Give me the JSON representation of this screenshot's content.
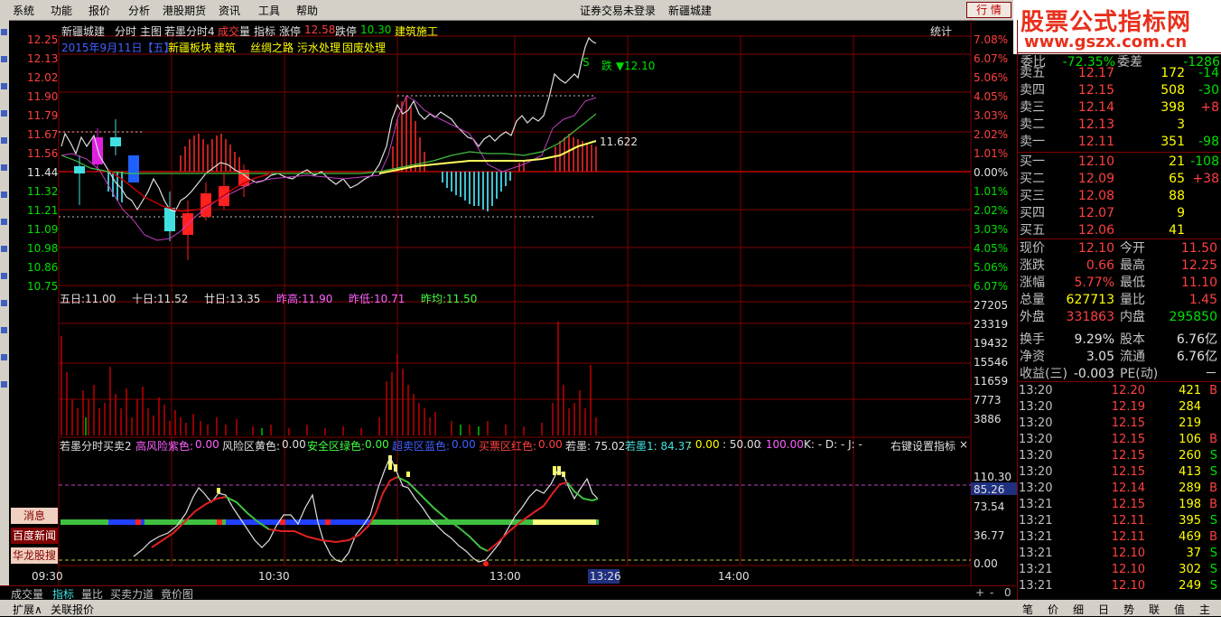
{
  "menu": {
    "items": [
      "系统",
      "功能",
      "报价",
      "分析",
      "港股期货",
      "资讯",
      "工具",
      "帮助"
    ],
    "status": "证券交易未登录",
    "stock": "新疆城建",
    "hq_button": "行 情"
  },
  "logo": {
    "line1": "股票公式指标网",
    "line2": "www.gszx.com.cn"
  },
  "side_buttons": [
    "消息",
    "百度新闻",
    "华龙股搜"
  ],
  "chart_header": {
    "stock": "新疆城建",
    "items": [
      "分时",
      "主图",
      "若墨分时4"
    ],
    "volume_label_1": "成交",
    "volume_label_2": "量",
    "indicator": "指标",
    "limit_up_label": "涨停",
    "limit_up": "12.58",
    "limit_down_label": "跌停",
    "limit_down": "10.30",
    "sector": "建筑施工",
    "stat_button": "统计",
    "date": "2015年9月11日【五】",
    "concepts": [
      "新疆板块",
      "建筑",
      "丝绸之路",
      "污水处理",
      "固废处理"
    ],
    "down_marker": "跌 ▼12.10",
    "avg_marker": "11.622",
    "s_marker": "S"
  },
  "price_axis": {
    "left": [
      "12.25",
      "12.13",
      "12.02",
      "11.90",
      "11.79",
      "11.67",
      "11.56",
      "11.44",
      "11.32",
      "11.21",
      "11.09",
      "10.98",
      "10.86",
      "10.75"
    ],
    "right": [
      "7.08%",
      "6.07%",
      "5.06%",
      "4.05%",
      "3.03%",
      "2.02%",
      "1.01%",
      "0.00%",
      "1.01%",
      "2.02%",
      "3.03%",
      "4.05%",
      "5.06%",
      "6.07%"
    ]
  },
  "ma_line": {
    "ma5": "五日:11.00",
    "ma10": "十日:11.52",
    "ma20": "廿日:13.35",
    "prev_high": "昨高:11.90",
    "prev_low": "昨低:10.71",
    "prev_avg": "昨均:11.50"
  },
  "volume_axis": [
    "27205",
    "23319",
    "19432",
    "15546",
    "11659",
    "7773",
    "3886"
  ],
  "indicator_header": {
    "name": "若墨分时买卖2",
    "high_risk": "高风险紫色:",
    "high_risk_v": "0.00",
    "risk": "风险区黄色:",
    "risk_v": "0.00",
    "safe": "安全区绿色:",
    "safe_v": "0.00",
    "oversold": "超卖区蓝色:",
    "oversold_v": "0.00",
    "buy": "买票区红色:",
    "buy_v": "0.00",
    "rm": "若墨: 75.02",
    "rm1": "若墨1: 84.37",
    "rm2": ": 0.00",
    "rm3": ": 50.00",
    "rm4": ": 100.00",
    "kdj": "K: -  D: -  J: -",
    "right_set": "右键设置指标",
    "close": "×"
  },
  "indicator_axis": [
    "110.30",
    "85.26",
    "73.54",
    "36.77",
    "0.00"
  ],
  "time_axis": [
    "09:30",
    "10:30",
    "13:00",
    "13:26",
    "14:00"
  ],
  "bottom_tabs": [
    "成交量",
    "指标",
    "量比",
    "买卖力道",
    "竟价图"
  ],
  "bottom_controls": [
    "+",
    "-",
    "0"
  ],
  "bottom_links": [
    "扩展∧",
    "关联报价"
  ],
  "right_tabs": [
    "笔",
    "价",
    "细",
    "日",
    "势",
    "联",
    "值",
    "主"
  ],
  "order_book": {
    "head": {
      "label1": "委比",
      "v1": "-72.35%",
      "label2": "委差",
      "v2": "-1286"
    },
    "sells": [
      {
        "label": "卖五",
        "price": "12.17",
        "vol": "172",
        "chg": "-14"
      },
      {
        "label": "卖四",
        "price": "12.15",
        "vol": "508",
        "chg": "-30"
      },
      {
        "label": "卖三",
        "price": "12.14",
        "vol": "398",
        "chg": "+8"
      },
      {
        "label": "卖二",
        "price": "12.13",
        "vol": "3",
        "chg": ""
      },
      {
        "label": "卖一",
        "price": "12.11",
        "vol": "351",
        "chg": "-98"
      }
    ],
    "buys": [
      {
        "label": "买一",
        "price": "12.10",
        "vol": "21",
        "chg": "-108"
      },
      {
        "label": "买二",
        "price": "12.09",
        "vol": "65",
        "chg": "+38"
      },
      {
        "label": "买三",
        "price": "12.08",
        "vol": "88",
        "chg": ""
      },
      {
        "label": "买四",
        "price": "12.07",
        "vol": "9",
        "chg": ""
      },
      {
        "label": "买五",
        "price": "12.06",
        "vol": "41",
        "chg": ""
      }
    ]
  },
  "quote": [
    {
      "l1": "现价",
      "v1": "12.10",
      "l2": "今开",
      "v2": "11.50"
    },
    {
      "l1": "涨跌",
      "v1": "0.66",
      "l2": "最高",
      "v2": "12.25"
    },
    {
      "l1": "涨幅",
      "v1": "5.77%",
      "l2": "最低",
      "v2": "11.10"
    },
    {
      "l1": "总量",
      "v1": "627713",
      "l2": "量比",
      "v2": "1.45"
    },
    {
      "l1": "外盘",
      "v1": "331863",
      "l2": "内盘",
      "v2": "295850"
    },
    {
      "l1": "换手",
      "v1": "9.29%",
      "l2": "股本",
      "v2": "6.76亿"
    },
    {
      "l1": "净资",
      "v1": "3.05",
      "l2": "流通",
      "v2": "6.76亿"
    },
    {
      "l1": "收益(三)",
      "v1": "-0.003",
      "l2": "PE(动)",
      "v2": "－"
    }
  ],
  "ticks": [
    {
      "t": "13:20",
      "p": "12.20",
      "v": "421",
      "s": "B"
    },
    {
      "t": "13:20",
      "p": "12.19",
      "v": "284",
      "s": ""
    },
    {
      "t": "13:20",
      "p": "12.15",
      "v": "219",
      "s": ""
    },
    {
      "t": "13:20",
      "p": "12.15",
      "v": "106",
      "s": "B"
    },
    {
      "t": "13:20",
      "p": "12.15",
      "v": "260",
      "s": "S"
    },
    {
      "t": "13:20",
      "p": "12.15",
      "v": "413",
      "s": "S"
    },
    {
      "t": "13:20",
      "p": "12.14",
      "v": "289",
      "s": "B"
    },
    {
      "t": "13:21",
      "p": "12.15",
      "v": "198",
      "s": "B"
    },
    {
      "t": "13:21",
      "p": "12.11",
      "v": "395",
      "s": "S"
    },
    {
      "t": "13:21",
      "p": "12.11",
      "v": "469",
      "s": "B"
    },
    {
      "t": "13:21",
      "p": "12.10",
      "v": "37",
      "s": "S"
    },
    {
      "t": "13:21",
      "p": "12.10",
      "v": "302",
      "s": "S"
    },
    {
      "t": "13:21",
      "p": "12.10",
      "v": "249",
      "s": "S"
    }
  ],
  "colors": {
    "up": "#ff4040",
    "down": "#00e000",
    "flat": "#e0e0e0",
    "volume": "#ffff00",
    "grid": "#800000"
  }
}
